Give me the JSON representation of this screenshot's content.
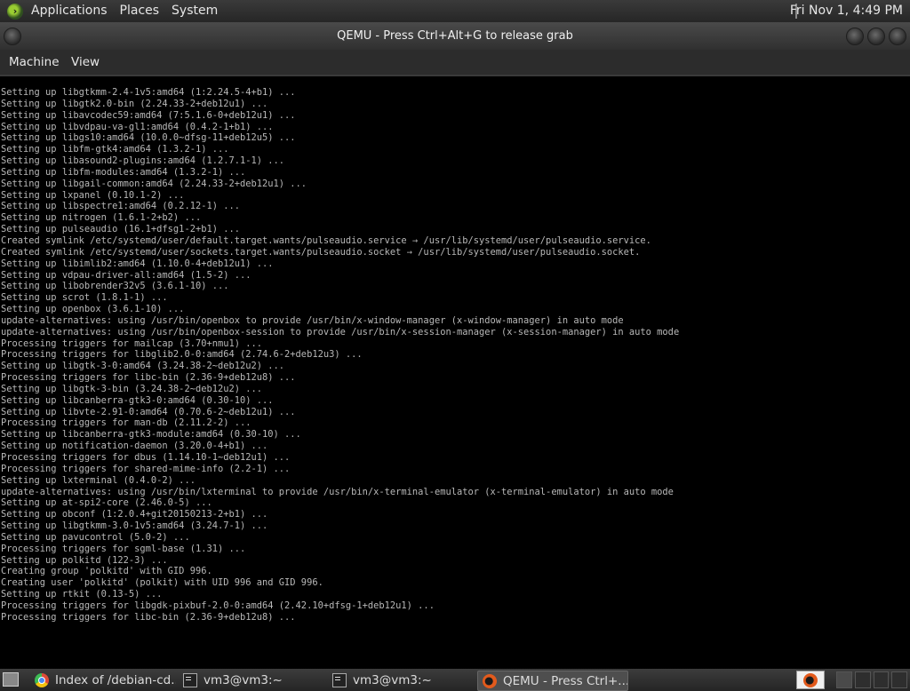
{
  "top_panel": {
    "menus": [
      "Applications",
      "Places",
      "System"
    ],
    "clock": "Fri Nov 1,  4:49 PM"
  },
  "window": {
    "title": "QEMU - Press Ctrl+Alt+G to release grab",
    "menu": [
      "Machine",
      "View"
    ]
  },
  "console_lines": [
    "Setting up libgtkmm-2.4-1v5:amd64 (1:2.24.5-4+b1) ...",
    "Setting up libgtk2.0-bin (2.24.33-2+deb12u1) ...",
    "Setting up libavcodec59:amd64 (7:5.1.6-0+deb12u1) ...",
    "Setting up libvdpau-va-gl1:amd64 (0.4.2-1+b1) ...",
    "Setting up libgs10:amd64 (10.0.0~dfsg-11+deb12u5) ...",
    "Setting up libfm-gtk4:amd64 (1.3.2-1) ...",
    "Setting up libasound2-plugins:amd64 (1.2.7.1-1) ...",
    "Setting up libfm-modules:amd64 (1.3.2-1) ...",
    "Setting up libgail-common:amd64 (2.24.33-2+deb12u1) ...",
    "Setting up lxpanel (0.10.1-2) ...",
    "Setting up libspectre1:amd64 (0.2.12-1) ...",
    "Setting up nitrogen (1.6.1-2+b2) ...",
    "Setting up pulseaudio (16.1+dfsg1-2+b1) ...",
    "Created symlink /etc/systemd/user/default.target.wants/pulseaudio.service → /usr/lib/systemd/user/pulseaudio.service.",
    "Created symlink /etc/systemd/user/sockets.target.wants/pulseaudio.socket → /usr/lib/systemd/user/pulseaudio.socket.",
    "Setting up libimlib2:amd64 (1.10.0-4+deb12u1) ...",
    "Setting up vdpau-driver-all:amd64 (1.5-2) ...",
    "Setting up libobrender32v5 (3.6.1-10) ...",
    "Setting up scrot (1.8.1-1) ...",
    "Setting up openbox (3.6.1-10) ...",
    "update-alternatives: using /usr/bin/openbox to provide /usr/bin/x-window-manager (x-window-manager) in auto mode",
    "update-alternatives: using /usr/bin/openbox-session to provide /usr/bin/x-session-manager (x-session-manager) in auto mode",
    "Processing triggers for mailcap (3.70+nmu1) ...",
    "Processing triggers for libglib2.0-0:amd64 (2.74.6-2+deb12u3) ...",
    "Setting up libgtk-3-0:amd64 (3.24.38-2~deb12u2) ...",
    "Processing triggers for libc-bin (2.36-9+deb12u8) ...",
    "Setting up libgtk-3-bin (3.24.38-2~deb12u2) ...",
    "Setting up libcanberra-gtk3-0:amd64 (0.30-10) ...",
    "Setting up libvte-2.91-0:amd64 (0.70.6-2~deb12u1) ...",
    "Processing triggers for man-db (2.11.2-2) ...",
    "Setting up libcanberra-gtk3-module:amd64 (0.30-10) ...",
    "Setting up notification-daemon (3.20.0-4+b1) ...",
    "Processing triggers for dbus (1.14.10-1~deb12u1) ...",
    "Processing triggers for shared-mime-info (2.2-1) ...",
    "Setting up lxterminal (0.4.0-2) ...",
    "update-alternatives: using /usr/bin/lxterminal to provide /usr/bin/x-terminal-emulator (x-terminal-emulator) in auto mode",
    "Setting up at-spi2-core (2.46.0-5) ...",
    "Setting up obconf (1:2.0.4+git20150213-2+b1) ...",
    "Setting up libgtkmm-3.0-1v5:amd64 (3.24.7-1) ...",
    "Setting up pavucontrol (5.0-2) ...",
    "Processing triggers for sgml-base (1.31) ...",
    "Setting up polkitd (122-3) ...",
    "Creating group 'polkitd' with GID 996.",
    "Creating user 'polkitd' (polkit) with UID 996 and GID 996.",
    "Setting up rtkit (0.13-5) ...",
    "Processing triggers for libgdk-pixbuf-2.0-0:amd64 (2.42.10+dfsg-1+deb12u1) ...",
    "Processing triggers for libc-bin (2.36-9+deb12u8) ..."
  ],
  "taskbar": {
    "tasks": [
      {
        "label": "Index of /debian-cd...",
        "icon": "chrome-icon"
      },
      {
        "label": "vm3@vm3:~",
        "icon": "terminal-icon"
      },
      {
        "label": "vm3@vm3:~",
        "icon": "terminal-icon"
      },
      {
        "label": "QEMU - Press Ctrl+...",
        "icon": "qemu-icon"
      }
    ]
  }
}
